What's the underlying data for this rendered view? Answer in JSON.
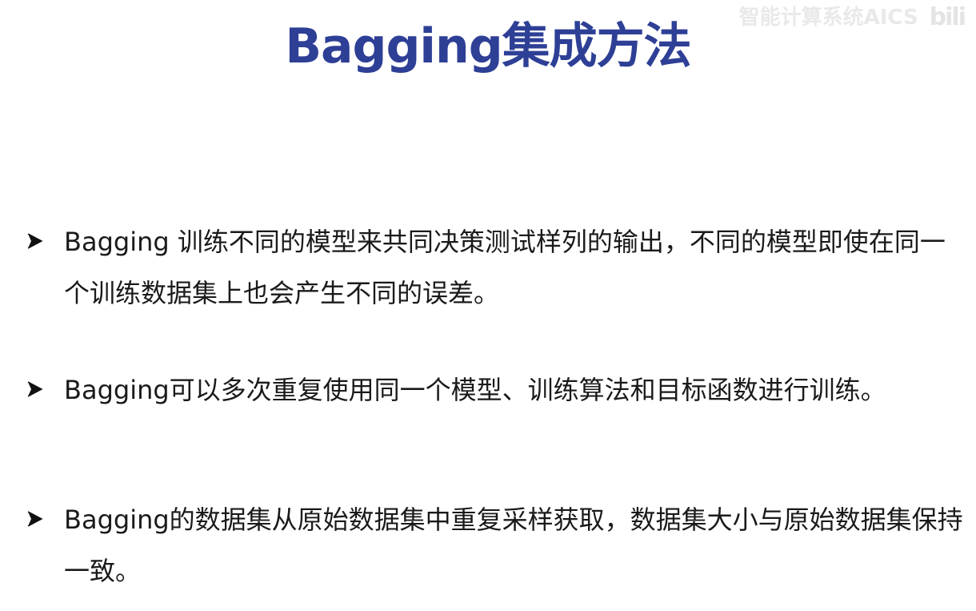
{
  "slide": {
    "title": "Bagging集成方法",
    "watermark": {
      "text": "智能计算系统AICS",
      "logo": "bili"
    },
    "bullets": [
      {
        "marker_icon": "arrow-right-icon",
        "text": "Bagging 训练不同的模型来共同决策测试样列的输出，不同的模型即使在同一个训练数据集上也会产生不同的误差。"
      },
      {
        "marker_icon": "arrow-right-icon",
        "text": "Bagging可以多次重复使用同一个模型、训练算法和目标函数进行训练。"
      },
      {
        "marker_icon": "arrow-right-icon",
        "text": "Bagging的数据集从原始数据集中重复采样获取，数据集大小与原始数据集保持一致。"
      }
    ],
    "colors": {
      "title": "#2e3f96",
      "text": "#1a1a1a",
      "background": "#ffffff",
      "watermark": "#e9e9e9"
    }
  }
}
